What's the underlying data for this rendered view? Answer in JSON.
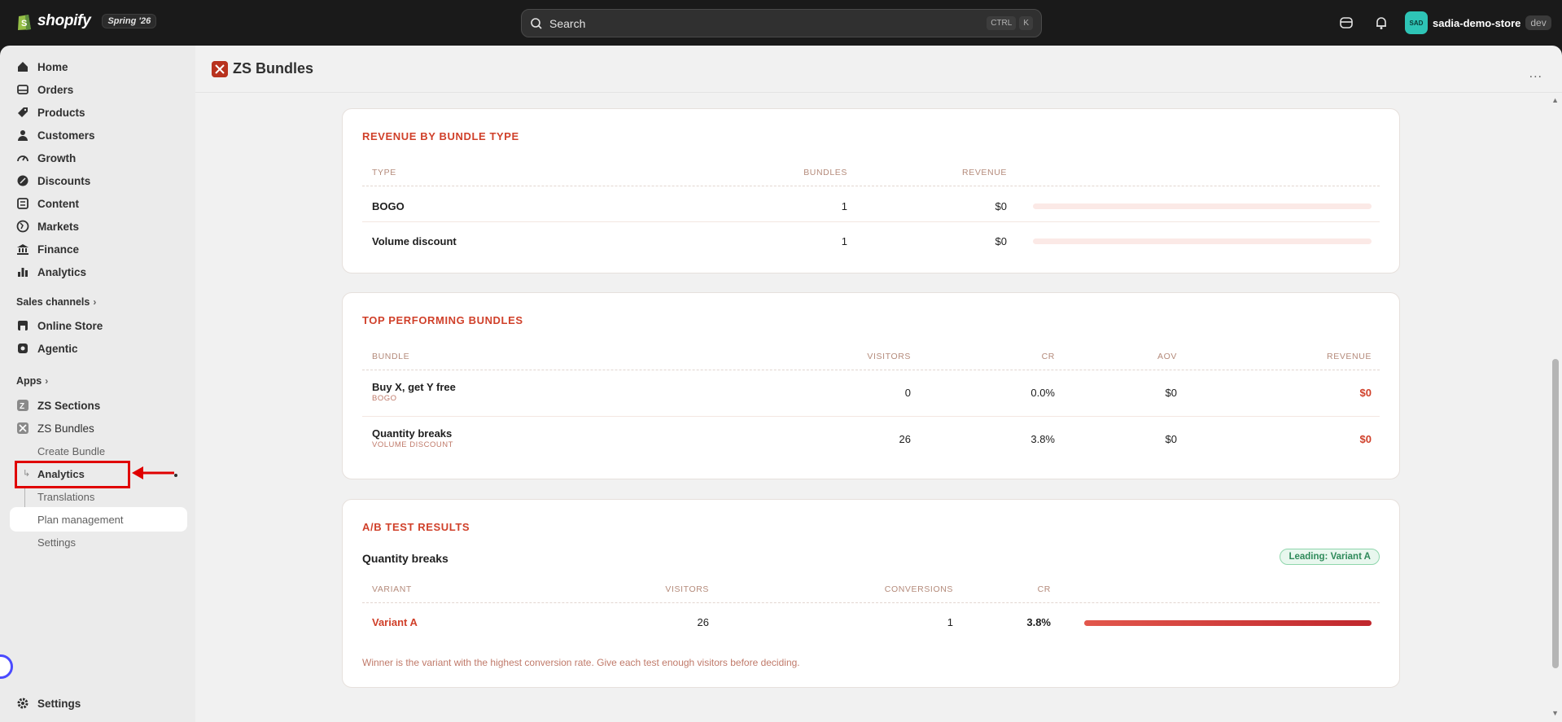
{
  "topbar": {
    "logo_text": "shopify",
    "edition": "Spring '26",
    "search_placeholder": "Search",
    "kbd_ctrl": "CTRL",
    "kbd_k": "K",
    "avatar_initials": "SAD",
    "store_name": "sadia-demo-store",
    "store_badge": "dev"
  },
  "sidebar": {
    "nav": [
      "Home",
      "Orders",
      "Products",
      "Customers",
      "Growth",
      "Discounts",
      "Content",
      "Markets",
      "Finance",
      "Analytics"
    ],
    "sales_channels_label": "Sales channels",
    "sales_channels": [
      "Online Store",
      "Agentic"
    ],
    "apps_label": "Apps",
    "apps": [
      "ZS Sections",
      "ZS Bundles"
    ],
    "bundles_sub": [
      "Create Bundle",
      "Analytics",
      "Translations",
      "Plan management",
      "Settings"
    ],
    "settings": "Settings"
  },
  "page": {
    "title": "ZS Bundles",
    "more": "..."
  },
  "revenue_by_type": {
    "title": "REVENUE BY BUNDLE TYPE",
    "headers": [
      "TYPE",
      "BUNDLES",
      "REVENUE"
    ],
    "rows": [
      {
        "type": "BOGO",
        "bundles": "1",
        "revenue": "$0",
        "share": 0
      },
      {
        "type": "Volume discount",
        "bundles": "1",
        "revenue": "$0",
        "share": 0
      }
    ]
  },
  "top_bundles": {
    "title": "TOP PERFORMING BUNDLES",
    "headers": [
      "BUNDLE",
      "VISITORS",
      "CR",
      "AOV",
      "REVENUE"
    ],
    "rows": [
      {
        "name": "Buy X, get Y free",
        "kind": "BOGO",
        "visitors": "0",
        "cr": "0.0%",
        "aov": "$0",
        "revenue": "$0"
      },
      {
        "name": "Quantity breaks",
        "kind": "VOLUME DISCOUNT",
        "visitors": "26",
        "cr": "3.8%",
        "aov": "$0",
        "revenue": "$0"
      }
    ]
  },
  "ab_test": {
    "title": "A/B TEST RESULTS",
    "test_name": "Quantity breaks",
    "leading_badge": "Leading: Variant A",
    "headers": [
      "VARIANT",
      "VISITORS",
      "CONVERSIONS",
      "CR"
    ],
    "rows": [
      {
        "variant": "Variant A",
        "visitors": "26",
        "conversions": "1",
        "cr": "3.8%",
        "share": 1.0
      }
    ],
    "footnote": "Winner is the variant with the highest conversion rate. Give each test enough visitors before deciding."
  },
  "colors": {
    "accent": "#d0402a",
    "topbar_bg": "#1a1a1a",
    "badge_green": "#2f8a5a",
    "highlight_red": "#e00000"
  }
}
